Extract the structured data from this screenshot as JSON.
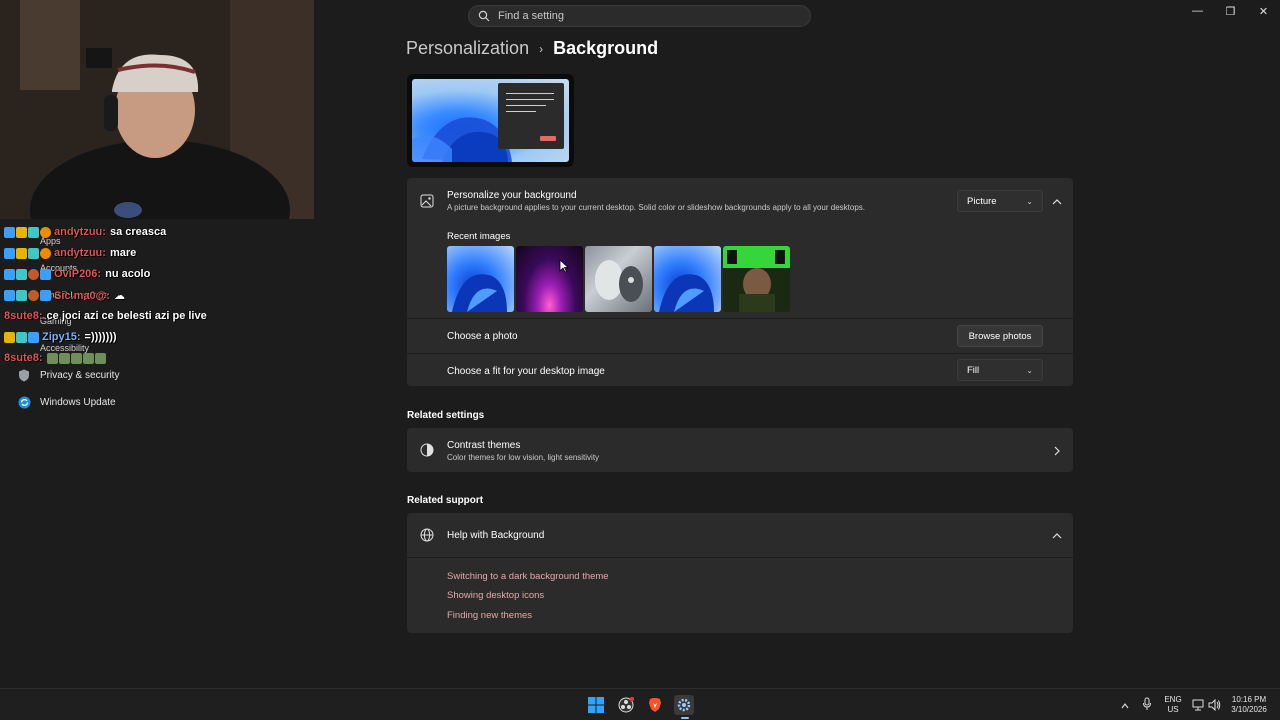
{
  "caption": {
    "search_placeholder": "Find a setting",
    "minimize": "—",
    "restore": "❐",
    "close": "✕"
  },
  "nav": {
    "items": [
      {
        "label": "Apps"
      },
      {
        "label": "Accounts"
      },
      {
        "label": "Time & language"
      },
      {
        "label": "Gaming"
      },
      {
        "label": "Accessibility"
      },
      {
        "label": "Privacy & security",
        "icon": "shield-icon"
      },
      {
        "label": "Windows Update",
        "icon": "update-icon"
      }
    ]
  },
  "chat": [
    {
      "user": "andytzuu:",
      "user_color": "#e05555",
      "message": "sa creasca"
    },
    {
      "user": "andytzuu:",
      "user_color": "#e05555",
      "message": "mare"
    },
    {
      "user": "OviP206:",
      "user_color": "#e05555",
      "message": "nu acolo"
    },
    {
      "user": "Sic.ma0@:",
      "user_color": "#e05555",
      "message": ""
    },
    {
      "user": "8sute8:",
      "user_color": "#e05555",
      "message": "ce joci azi ce belesti azi pe live"
    },
    {
      "user": "Zipy15:",
      "user_color": "#7db0ff",
      "message": "=)))))))"
    },
    {
      "user": "8sute8:",
      "user_color": "#e05555",
      "message": ""
    }
  ],
  "breadcrumb": {
    "parent": "Personalization",
    "separator": "›",
    "current": "Background"
  },
  "personalize": {
    "title": "Personalize your background",
    "description": "A picture background applies to your current desktop. Solid color or slideshow backgrounds apply to all your desktops.",
    "dropdown_value": "Picture",
    "recent_images_label": "Recent images",
    "choose_photo_label": "Choose a photo",
    "browse_button": "Browse photos",
    "fit_label": "Choose a fit for your desktop image",
    "fit_value": "Fill"
  },
  "related_settings": {
    "heading": "Related settings",
    "contrast_title": "Contrast themes",
    "contrast_desc": "Color themes for low vision, light sensitivity"
  },
  "related_support": {
    "heading": "Related support",
    "help_title": "Help with Background",
    "links": [
      "Switching to a dark background theme",
      "Showing desktop icons",
      "Finding new themes"
    ]
  },
  "taskbar": {
    "lang_top": "ENG",
    "lang_bottom": "US",
    "time": "10:16 PM",
    "date": "3/10/2026"
  },
  "colors": {
    "accent_link": "#e7a7a7",
    "background": "#1c1c1c",
    "card": "#2b2b2b"
  }
}
